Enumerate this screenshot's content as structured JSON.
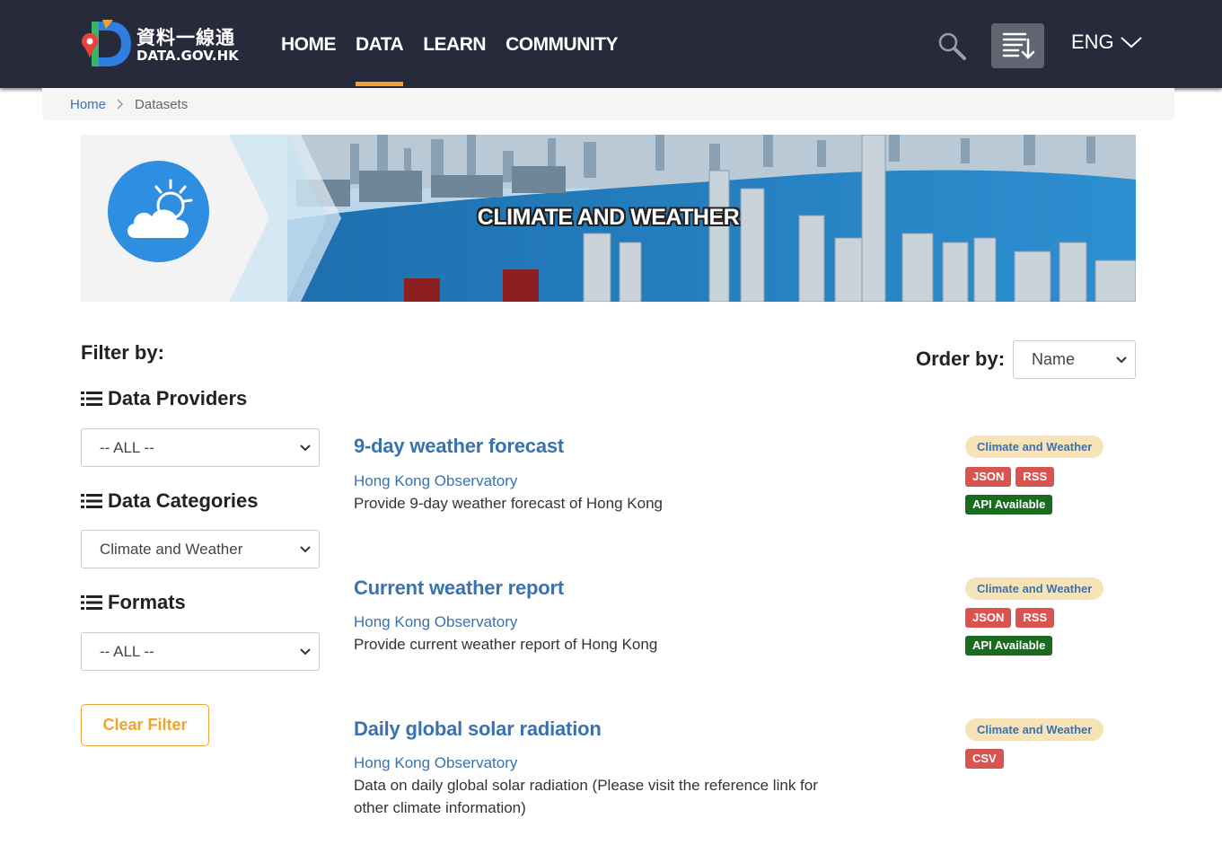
{
  "header": {
    "logo_cn": "資料一線通",
    "logo_en": "DATA.GOV.HK",
    "nav": [
      {
        "label": "HOME",
        "active": false
      },
      {
        "label": "DATA",
        "active": true
      },
      {
        "label": "LEARN",
        "active": false
      },
      {
        "label": "COMMUNITY",
        "active": false
      }
    ],
    "language": "ENG"
  },
  "breadcrumb": {
    "home": "Home",
    "current": "Datasets"
  },
  "banner": {
    "title": "CLIMATE AND WEATHER"
  },
  "filters": {
    "title": "Filter by:",
    "providers": {
      "heading": "Data Providers",
      "selected": "-- ALL --"
    },
    "categories": {
      "heading": "Data Categories",
      "selected": "Climate and Weather"
    },
    "formats": {
      "heading": "Formats",
      "selected": "-- ALL --"
    },
    "clear_label": "Clear Filter"
  },
  "order": {
    "label": "Order by:",
    "selected": "Name"
  },
  "datasets": [
    {
      "title": "9-day weather forecast",
      "provider": "Hong Kong Observatory",
      "description": "Provide 9-day weather forecast of Hong Kong",
      "category": "Climate and Weather",
      "formats": [
        "JSON",
        "RSS"
      ],
      "api": "API Available"
    },
    {
      "title": "Current weather report",
      "provider": "Hong Kong Observatory",
      "description": "Provide current weather report of Hong Kong",
      "category": "Climate and Weather",
      "formats": [
        "JSON",
        "RSS"
      ],
      "api": "API Available"
    },
    {
      "title": "Daily global solar radiation",
      "provider": "Hong Kong Observatory",
      "description": "Data on daily global solar radiation (Please visit the reference link for other climate information)",
      "category": "Climate and Weather",
      "formats": [
        "CSV"
      ],
      "api": ""
    }
  ],
  "colors": {
    "header_bg": "#272a3b",
    "accent": "#f2a230",
    "link": "#3a72b0",
    "format_tag": "#d9534f",
    "api_tag": "#1a6b1f",
    "category_tag_bg": "#f7e3b8"
  }
}
